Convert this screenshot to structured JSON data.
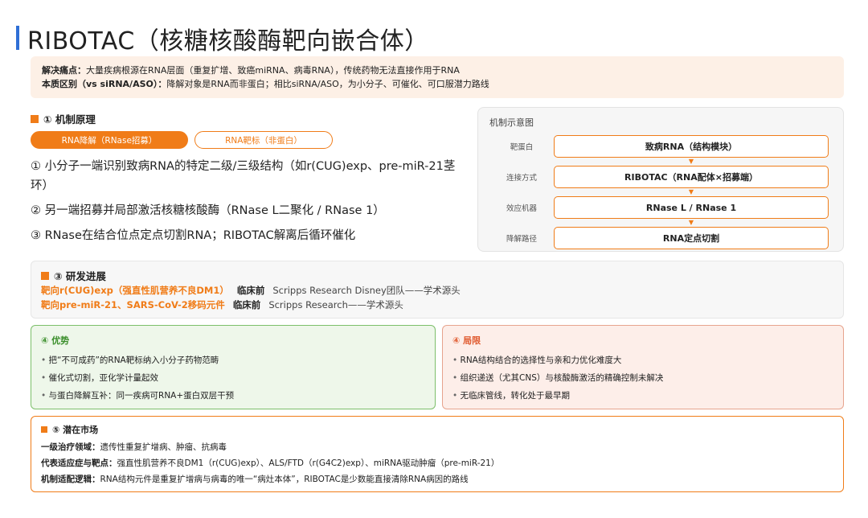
{
  "title": "RIBOTAC（核糖核酸酶靶向嵌合体）",
  "intro": {
    "line1_label": "解决痛点：",
    "line1_text": "大量疾病根源在RNA层面（重复扩增、致癌miRNA、病毒RNA），传统药物无法直接作用于RNA",
    "line2_label": "本质区别（vs siRNA/ASO）：",
    "line2_text": "降解对象是RNA而非蛋白；相比siRNA/ASO，为小分子、可催化、可口服潜力路线"
  },
  "mechanism": {
    "heading": "① 机制原理",
    "tabs": [
      "RNA降解（RNase招募）",
      "RNA靶标（非蛋白）"
    ],
    "steps": [
      "① 小分子一端识别致病RNA的特定二级/三级结构（如r(CUG)exp、pre-miR-21茎环）",
      "② 另一端招募并局部激活核糖核酸酶（RNase L二聚化 / RNase 1）",
      "③ RNase在结合位点定点切割RNA；RIBOTAC解离后循环催化"
    ]
  },
  "diagram": {
    "title": "机制示意图",
    "rows": [
      {
        "label": "靶蛋白",
        "box": "致病RNA（结构模块）"
      },
      {
        "label": "连接方式",
        "box": "RIBOTAC（RNA配体×招募端）"
      },
      {
        "label": "效应机器",
        "box": "RNase L / RNase 1"
      },
      {
        "label": "降解路径",
        "box": "RNA定点切割"
      }
    ],
    "arrow": "▼"
  },
  "progress": {
    "heading": "③ 研发进展",
    "items": [
      {
        "target": "靶向r(CUG)exp（强直性肌营养不良DM1）",
        "stage": "临床前",
        "source": "Scripps Research Disney团队——学术源头"
      },
      {
        "target": "靶向pre-miR-21、SARS-CoV-2移码元件",
        "stage": "临床前",
        "source": "Scripps Research——学术源头"
      }
    ]
  },
  "advantages": {
    "heading": "④ 优势",
    "items": [
      "把“不可成药”的RNA靶标纳入小分子药物范畴",
      "催化式切割，亚化学计量起效",
      "与蛋白降解互补：同一疾病可RNA+蛋白双层干预"
    ]
  },
  "limitations": {
    "heading": "④ 局限",
    "items": [
      "RNA结构结合的选择性与亲和力优化难度大",
      "组织递送（尤其CNS）与核酸酶激活的精确控制未解决",
      "无临床管线，转化处于最早期"
    ]
  },
  "market": {
    "heading": "⑤ 潜在市场",
    "lines": [
      {
        "label": "一级治疗领域：",
        "text": "遗传性重复扩增病、肿瘤、抗病毒"
      },
      {
        "label": "代表适应症与靶点：",
        "text": "强直性肌营养不良DM1（r(CUG)exp）、ALS/FTD（r(G4C2)exp）、miRNA驱动肿瘤（pre-miR-21）"
      },
      {
        "label": "机制适配逻辑：",
        "text": "RNA结构元件是重复扩增病与病毒的唯一“病灶本体”，RIBOTAC是少数能直接清除RNA病因的路线"
      }
    ]
  },
  "colors": {
    "accent": "#f07c18",
    "title_bar": "#2f6fd6",
    "pros": "#3a8e2a",
    "cons": "#e05a2f"
  }
}
